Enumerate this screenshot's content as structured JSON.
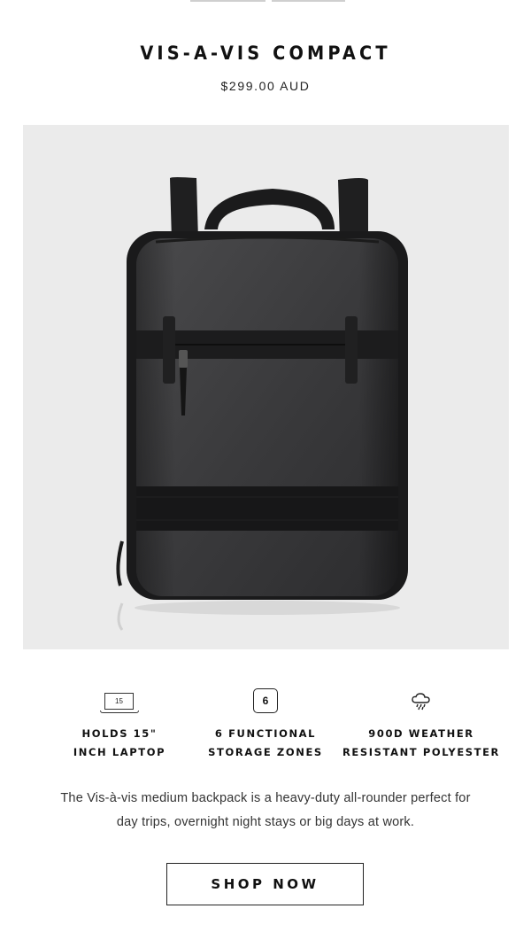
{
  "product": {
    "title": "VIS-A-VIS COMPACT",
    "price": "$299.00 AUD"
  },
  "hero": {
    "image": "black-backpack-photo",
    "background_color": "#ebebeb"
  },
  "features": [
    {
      "icon": "laptop-icon",
      "icon_text": "15",
      "label": "HOLDS 15\"\nINCH LAPTOP"
    },
    {
      "icon": "storage-zones-icon",
      "icon_text": "6",
      "label": "6 FUNCTIONAL\nSTORAGE ZONES"
    },
    {
      "icon": "rain-cloud-icon",
      "label": "900D WEATHER\nRESISTANT POLYESTER"
    }
  ],
  "description": "The Vis-à-vis medium backpack is a heavy-duty all-rounder perfect for day trips, overnight night stays or big days at work.",
  "cta": {
    "label": "SHOP NOW"
  }
}
